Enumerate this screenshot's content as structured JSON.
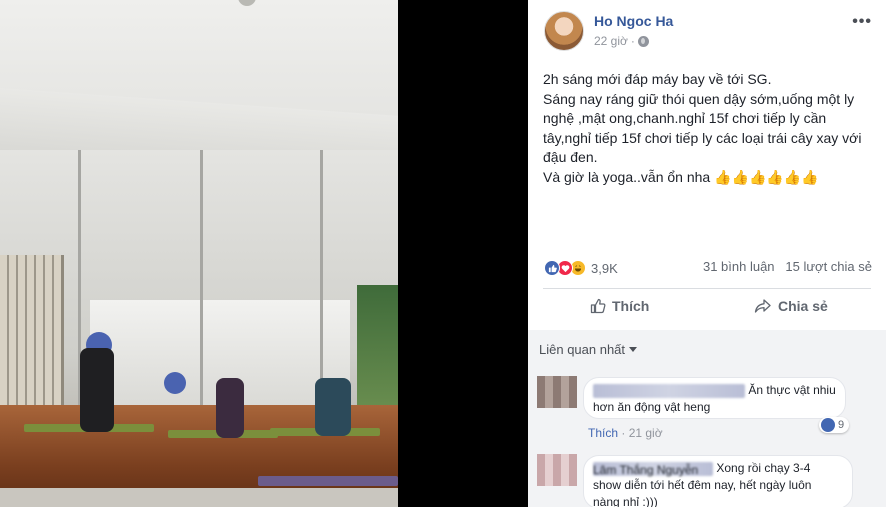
{
  "post": {
    "author": "Ho Ngoc Ha",
    "time": "22 giờ",
    "text_lines": [
      "2h sáng mới đáp máy bay về tới SG.",
      "Sáng nay ráng giữ thói quen dậy sớm,uống một ly",
      "nghệ ,mật ong,chanh.nghỉ 15f chơi tiếp ly cần",
      "tây,nghỉ tiếp 15f chơi tiếp ly các loại trái cây xay với",
      "đậu đen.",
      "Và giờ là yoga..vẫn ổn nha 👍👍👍👍👍👍"
    ],
    "reaction_count": "3,9K",
    "comments_count": "31 bình luận",
    "shares_count": "15 lượt chia sẻ",
    "actions": {
      "like": "Thích",
      "share": "Chia sẻ"
    }
  },
  "comments_section": {
    "sort_label": "Liên quan nhất",
    "comments": [
      {
        "name": "",
        "text_lines": [
          "Ăn thực vật nhiu",
          "hơn ăn động vật heng"
        ],
        "like_label": "Thích",
        "time": "21 giờ",
        "reaction_count": "9"
      },
      {
        "name": "Lâm Thắng Nguyễn",
        "text_lines": [
          "Xong rồi chạy 3-4",
          "show diễn tới hết đêm nay, hết ngày luôn",
          "nàng nhỉ :)))"
        ]
      }
    ]
  },
  "colors": {
    "link_blue": "#365899",
    "like_blue": "#4267b2",
    "love_red": "#f0284a",
    "haha_yellow": "#f7b928"
  },
  "icons": [
    "globe-icon",
    "more-icon",
    "like-icon",
    "share-icon",
    "caret-down-icon"
  ]
}
